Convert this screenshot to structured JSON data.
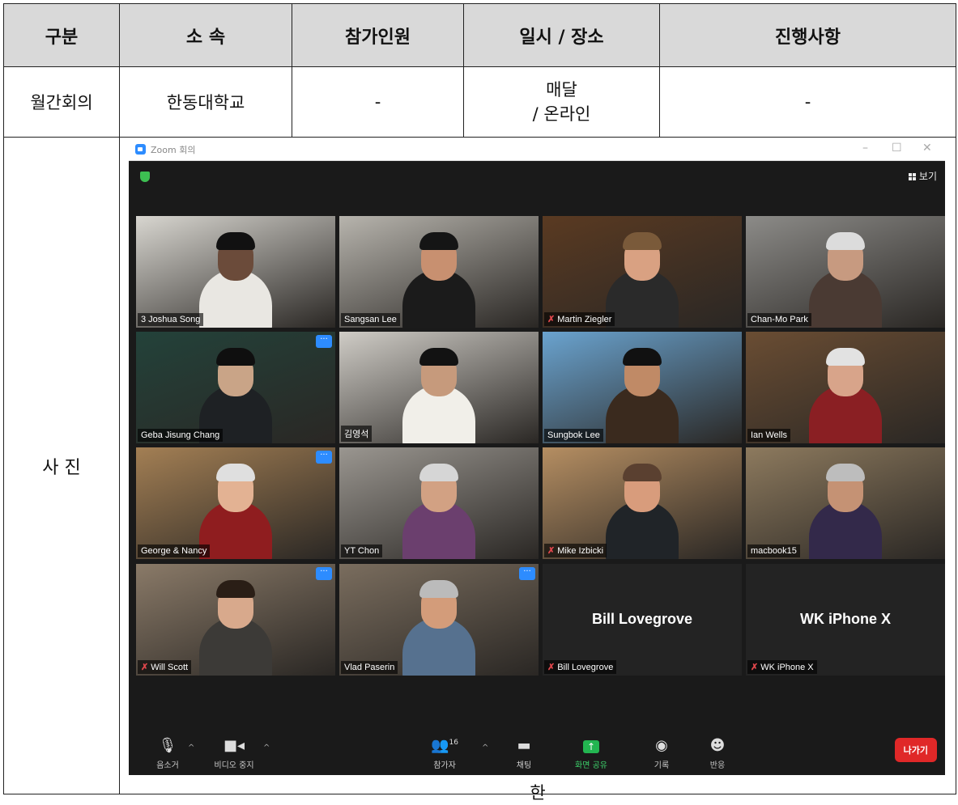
{
  "table": {
    "headers": [
      "구분",
      "소 속",
      "참가인원",
      "일시 / 장소",
      "진행사항"
    ],
    "row1": {
      "category": "월간회의",
      "affiliation": "한동대학교",
      "participants": "-",
      "schedule_line1": "매달",
      "schedule_line2": "/ 온라인",
      "progress": "-"
    },
    "photo_label": "사 진",
    "photo_caption": "한"
  },
  "zoom": {
    "window_title": "Zoom 회의",
    "view_label": "보기",
    "tiles": [
      {
        "name": "3 Joshua Song",
        "muted": false,
        "more": false,
        "active": false,
        "bg": "#d8d6d0",
        "skin": "#6b4b3a",
        "shirt": "#e9e7e2",
        "hair": "#111"
      },
      {
        "name": "Sangsan Lee",
        "muted": false,
        "more": false,
        "active": false,
        "bg": "#b7b4ad",
        "skin": "#c89070",
        "shirt": "#1b1b1b",
        "hair": "#151515"
      },
      {
        "name": "Martin Ziegler",
        "muted": true,
        "more": false,
        "active": false,
        "bg": "#5a3a22",
        "skin": "#d9a182",
        "shirt": "#2a2a2a",
        "hair": "#7a5a3a"
      },
      {
        "name": "Chan-Mo Park",
        "muted": false,
        "more": false,
        "active": false,
        "bg": "#8c8b88",
        "skin": "#c79a80",
        "shirt": "#4a3a33",
        "hair": "#dcdcdc"
      },
      {
        "name": "Geba Jisung Chang",
        "muted": false,
        "more": true,
        "active": false,
        "bg": "#23423a",
        "skin": "#c9a487",
        "shirt": "#1e2124",
        "hair": "#0f0f0f"
      },
      {
        "name": "김영석",
        "muted": false,
        "more": false,
        "active": false,
        "bg": "#cfccc6",
        "skin": "#c69a7c",
        "shirt": "#f1efe9",
        "hair": "#121212"
      },
      {
        "name": "Sungbok Lee",
        "muted": false,
        "more": false,
        "active": false,
        "bg": "#6aa3cf",
        "skin": "#c08a66",
        "shirt": "#3a2a1e",
        "hair": "#111"
      },
      {
        "name": "Ian Wells",
        "muted": false,
        "more": false,
        "active": false,
        "bg": "#6a4d33",
        "skin": "#d8a48a",
        "shirt": "#8a1f23",
        "hair": "#e2e2e2"
      },
      {
        "name": "George & Nancy",
        "muted": false,
        "more": true,
        "active": true,
        "bg": "#a37f54",
        "skin": "#e3b293",
        "shirt": "#8f1d1f",
        "hair": "#dfdfdf"
      },
      {
        "name": "YT Chon",
        "muted": false,
        "more": false,
        "active": false,
        "bg": "#9a9690",
        "skin": "#d2a183",
        "shirt": "#6b3f6e",
        "hair": "#d6d6d6"
      },
      {
        "name": "Mike Izbicki",
        "muted": true,
        "more": false,
        "active": false,
        "bg": "#b58e62",
        "skin": "#d89c7c",
        "shirt": "#202428",
        "hair": "#5a4030"
      },
      {
        "name": "macbook15",
        "muted": false,
        "more": false,
        "active": false,
        "bg": "#8d7a5e",
        "skin": "#c59274",
        "shirt": "#33294a",
        "hair": "#bdbdbd"
      },
      {
        "name": "Will Scott",
        "muted": true,
        "more": true,
        "active": false,
        "bg": "#8a7a68",
        "skin": "#d8a98c",
        "shirt": "#3c3a37",
        "hair": "#2a1e16"
      },
      {
        "name": "Vlad Paserin",
        "muted": false,
        "more": true,
        "active": false,
        "bg": "#7a6d5e",
        "skin": "#d39c7a",
        "shirt": "#56718f",
        "hair": "#bbbbbb"
      },
      {
        "name": "Bill Lovegrove",
        "muted": true,
        "more": false,
        "active": false,
        "placeholder": "Bill Lovegrove"
      },
      {
        "name": "WK iPhone X",
        "muted": true,
        "more": false,
        "active": false,
        "placeholder": "WK iPhone X"
      }
    ],
    "toolbar": {
      "mute": "음소거",
      "video": "비디오 중지",
      "participants": "참가자",
      "participants_count": "16",
      "chat": "채팅",
      "share": "화면 공유",
      "record": "기록",
      "reactions": "반응",
      "leave": "나가기"
    }
  }
}
